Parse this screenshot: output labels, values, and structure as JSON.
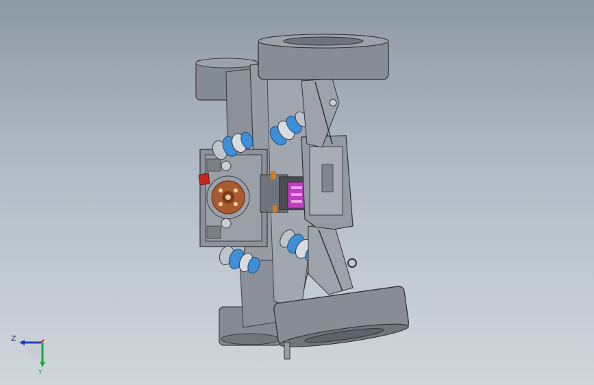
{
  "viewport": {
    "background_top": "#8e99a6",
    "background_bottom": "#d0d6dc"
  },
  "model": {
    "body_color": "#8f949c",
    "body_dark": "#6e737b",
    "wheel_color": "#878c95",
    "bellows_color": "#3f8fd6",
    "pcb_color": "#c03fbf",
    "hub_color": "#b05a2a"
  },
  "triad": {
    "z_label": "Z",
    "y_label": "Y",
    "x_color": "#d02020",
    "y_color": "#1aa63a",
    "z_color": "#2b3fb0"
  }
}
